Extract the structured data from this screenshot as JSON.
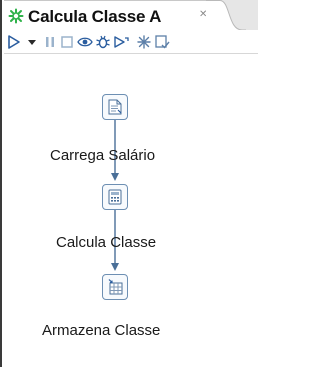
{
  "editor": {
    "tab_title": "Calcula Classe A",
    "close_symbol": "✕",
    "tab_icon": "job-icon",
    "accent_color": "#2fb24a"
  },
  "toolbar": {
    "items": [
      {
        "icon": "run-icon"
      },
      {
        "icon": "dropdown-arrow-icon"
      },
      {
        "icon": "pause-icon"
      },
      {
        "icon": "stop-icon"
      },
      {
        "icon": "preview-icon"
      },
      {
        "icon": "debug-icon"
      },
      {
        "icon": "replay-icon"
      },
      {
        "icon": "impact-analysis-icon"
      },
      {
        "icon": "check-icon"
      }
    ]
  },
  "steps": [
    {
      "label": "Carrega Salário",
      "icon": "text-file-input-icon"
    },
    {
      "label": "Calcula Classe",
      "icon": "calculator-icon"
    },
    {
      "label": "Armazena Classe",
      "icon": "table-output-icon"
    }
  ],
  "colors": {
    "node_border": "#6d8fb3",
    "hop_line": "#4a6f98"
  }
}
